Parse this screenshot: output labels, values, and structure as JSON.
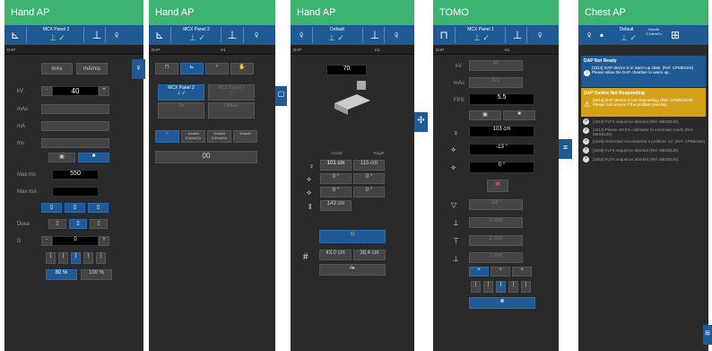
{
  "panels": [
    {
      "title": "Hand AP"
    },
    {
      "title": "Hand AP"
    },
    {
      "title": "Hand AP"
    },
    {
      "title": "TOMO"
    },
    {
      "title": "Chest AP"
    }
  ],
  "p1": {
    "dap": "DAP",
    "mas": "mAs",
    "mamc": "mA/ms",
    "rows": [
      "kV",
      "mAs",
      "mA",
      "ms"
    ],
    "kv": "40",
    "maxms": "Max ms",
    "maxms_val": "550",
    "maxma": "Max mA",
    "dose": "Dose",
    "d": "D",
    "d_val": "0",
    "pct1": "80 %",
    "pct2": "100 %"
  },
  "p2": {
    "dap": "DAP",
    "h1": "H1",
    "panel2": "MCX Panel 2",
    "panel1": "MCX Panel 1",
    "g1": "Cfr",
    "g2": "Default",
    "f0": "-",
    "f1": "1mmAl 0.1mmCu",
    "f2": "1mmAl 0.2mmCu",
    "f3": "2mmAl",
    "tool": "00"
  },
  "p3": {
    "dap": "DAP",
    "h1": "H1",
    "sid": "70",
    "actual": "Actual",
    "target": "Target",
    "rows": [
      [
        "101 cm",
        "115 cm"
      ],
      [
        "0 °",
        "0 °"
      ],
      [
        "0 °",
        "0 °"
      ],
      [
        "143 cm",
        ""
      ]
    ],
    "dim1": "43,0 cm",
    "dim2": "38,4 cm"
  },
  "p4": {
    "dap": "DAP",
    "h1": "H1",
    "kv": "kV",
    "kv_val": "40",
    "mas": "mAs",
    "mas_val": "0.1",
    "fps": "FPS",
    "fps_val": "5.5",
    "v1": "103 cm",
    "v2": "-13 °",
    "v3": "0 °",
    "v4": "-22 °",
    "v5": "0 mm",
    "v6": "2 mm",
    "v7": "2 mm"
  },
  "p5": {
    "hdr1": "Default",
    "filt": "1mmAl 0.1mmCu",
    "alert1_title": "DAP Not Ready",
    "alert1_text": "[1514] DAP device is in warm-up state. (Ref. CPMESSS)",
    "alert1_hint": "Please allow the DAP chamber to warm up.",
    "alert2_title": "DAP Device Not Responding",
    "alert2_text": "[1514] DAP device is not responding. (Ref. CPMESS29)",
    "alert2_hint": "Please call service if the problem persists.",
    "msgs": [
      "[1510] FLFS sequence aborted (Ref. MES5130)",
      "[1514] Please set the collimator to Automatic mode (Ref. MES5135)",
      "[1540] Generator encountered a problem: 44. (Ref. CPMES52)",
      "[1548] FLFS sequence aborted (Ref. MES5130)",
      "[1562] FLFS sequence aborted (Ref. MES5130)"
    ]
  },
  "colors": {
    "accent": "#1f5a94",
    "header": "#3cb371",
    "warn": "#d4a017"
  }
}
